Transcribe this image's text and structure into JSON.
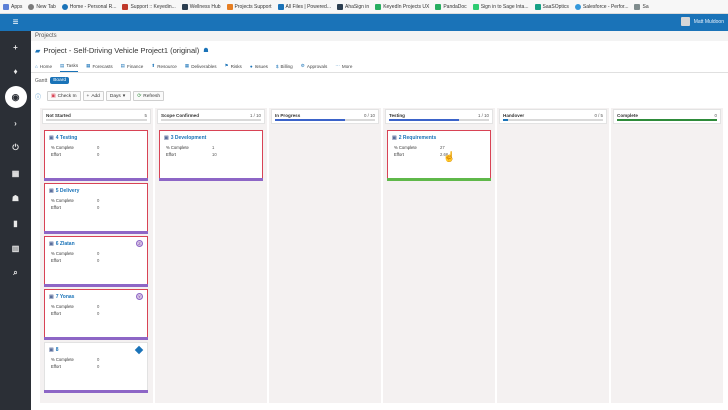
{
  "bookmarks": [
    {
      "label": "Apps",
      "color": "#5b7fd6"
    },
    {
      "label": "New Tab",
      "color": "#7a7a7a"
    },
    {
      "label": "Home - Personal R...",
      "color": "#1a73b8"
    },
    {
      "label": "Support :: Keyedin...",
      "color": "#c0392b"
    },
    {
      "label": "Wellness Hub",
      "color": "#2c3e50"
    },
    {
      "label": "Projects Support",
      "color": "#e67e22"
    },
    {
      "label": "All Files | Powered...",
      "color": "#1a73b8"
    },
    {
      "label": "AhaSign in",
      "color": "#2c3e50"
    },
    {
      "label": "KeyedIn Projects UX",
      "color": "#27ae60"
    },
    {
      "label": "PandaDoc",
      "color": "#27ae60"
    },
    {
      "label": "Sign in to Sage Inta...",
      "color": "#2ecc71"
    },
    {
      "label": "SaaSOptics",
      "color": "#16a085"
    },
    {
      "label": "Salesforce - Perfor...",
      "color": "#3498db"
    },
    {
      "label": "Sa",
      "color": "#7f8c8d"
    }
  ],
  "topbar": {
    "user_name": "Matt Muldoon",
    "color": "#1a73b8"
  },
  "sidebar": {
    "menu_icon": "≡",
    "icons": [
      "+",
      "♦",
      "◉",
      "›",
      "⏻",
      "▦",
      "☗",
      "▮",
      "▥",
      "⌕"
    ]
  },
  "breadcrumb": "Projects",
  "project": {
    "title": "Project - Self-Driving Vehicle Project1 (original)"
  },
  "tabs": [
    {
      "label": "Home",
      "icon": "⌂"
    },
    {
      "label": "Tasks",
      "icon": "▤"
    },
    {
      "label": "Forecasts",
      "icon": "▦"
    },
    {
      "label": "Finance",
      "icon": "▤"
    },
    {
      "label": "Resource",
      "icon": "⬆"
    },
    {
      "label": "Deliverables",
      "icon": "▦"
    },
    {
      "label": "Risks",
      "icon": "⚑"
    },
    {
      "label": "Issues",
      "icon": "●"
    },
    {
      "label": "Billing",
      "icon": "$"
    },
    {
      "label": "Approvals",
      "icon": "⚙"
    },
    {
      "label": "More",
      "icon": "⋯"
    }
  ],
  "view": {
    "label": "Gantt",
    "selected": "Board"
  },
  "toolbar": {
    "checkin": "Check In",
    "add": "Add",
    "days": "Days",
    "refresh": "Refresh"
  },
  "columns": [
    {
      "title": "Not Started",
      "count": "5",
      "progress": 0,
      "color": "#1a73b8"
    },
    {
      "title": "Scope Confirmed",
      "count": "1 / 10",
      "progress": 0,
      "color": "#1a73b8"
    },
    {
      "title": "In Progress",
      "count": "0 / 10",
      "progress": 0.7,
      "color": "#3b63c9"
    },
    {
      "title": "Testing",
      "count": "1 / 10",
      "progress": 0.7,
      "color": "#3b63c9"
    },
    {
      "title": "Handover",
      "count": "0 / 5",
      "progress": 0.05,
      "color": "#1a73b8"
    },
    {
      "title": "Complete",
      "count": "0",
      "progress": 1.0,
      "color": "#2e8b3a"
    }
  ],
  "cards": [
    {
      "title": "4 Testing",
      "pc_label": "% Complete",
      "pc_val": "0",
      "eff_label": "Effort",
      "eff_val": "0",
      "badge": ""
    },
    {
      "title": "5 Delivery",
      "pc_label": "% Complete",
      "pc_val": "0",
      "eff_label": "Effort",
      "eff_val": "0",
      "badge": ""
    },
    {
      "title": "6 Zlatan",
      "pc_label": "% Complete",
      "pc_val": "0",
      "eff_label": "Effort",
      "eff_val": "0",
      "badge": "Z"
    },
    {
      "title": "7 Yonas",
      "pc_label": "% Complete",
      "pc_val": "0",
      "eff_label": "Effort",
      "eff_val": "0",
      "badge": "Y"
    },
    {
      "title": "8",
      "pc_label": "% Complete",
      "pc_val": "0",
      "eff_label": "Effort",
      "eff_val": "0",
      "badge": ""
    },
    {
      "title": "3 Development",
      "pc_label": "% Complete",
      "pc_val": "1",
      "eff_label": "Effort",
      "eff_val": "10",
      "badge": ""
    },
    {
      "title": "2 Requirements",
      "pc_label": "% Complete",
      "pc_val": "27",
      "eff_label": "Effort",
      "eff_val": "2.66",
      "badge": ""
    }
  ]
}
